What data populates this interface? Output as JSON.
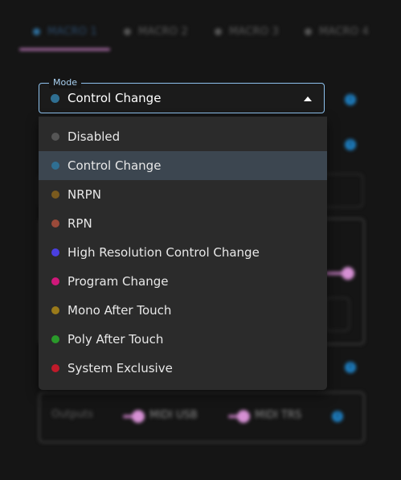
{
  "tabs": [
    {
      "label": "MACRO 1",
      "active": true
    },
    {
      "label": "MACRO 2",
      "active": false
    },
    {
      "label": "MACRO 3",
      "active": false
    },
    {
      "label": "MACRO 4",
      "active": false
    }
  ],
  "mode": {
    "legend": "Mode",
    "selected": "Control Change",
    "selected_color": "#2f6f92",
    "options": [
      {
        "label": "Disabled",
        "color": "#555555"
      },
      {
        "label": "Control Change",
        "color": "#2f6f92"
      },
      {
        "label": "NRPN",
        "color": "#7a5a1e"
      },
      {
        "label": "RPN",
        "color": "#9a4a3a"
      },
      {
        "label": "High Resolution Control Change",
        "color": "#4a3fe0"
      },
      {
        "label": "Program Change",
        "color": "#d0187a"
      },
      {
        "label": "Mono After Touch",
        "color": "#9a7a1a"
      },
      {
        "label": "Poly After Touch",
        "color": "#2a9a2a"
      },
      {
        "label": "System Exclusive",
        "color": "#c01a2a"
      }
    ]
  },
  "outputs": {
    "label": "Outputs",
    "midi_usb": "MIDI USB",
    "midi_trs": "MIDI TRS"
  },
  "colors": {
    "accent": "#b774b4",
    "focus": "#8ec2ee",
    "info": "#1e7ec0"
  }
}
